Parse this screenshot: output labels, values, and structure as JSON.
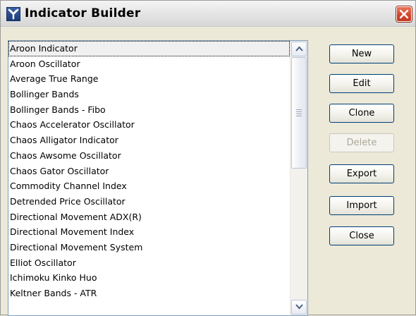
{
  "window": {
    "title": "Indicator Builder",
    "icon": "app-logo-icon",
    "close_icon": "close-icon"
  },
  "indicators": {
    "selected_index": 0,
    "items": [
      "Aroon Indicator",
      "Aroon Oscillator",
      "Average True Range",
      "Bollinger Bands",
      "Bollinger Bands - Fibo",
      "Chaos Accelerator Oscillator",
      "Chaos Alligator Indicator",
      "Chaos Awsome Oscillator",
      "Chaos Gator Oscillator",
      "Commodity Channel Index",
      "Detrended Price Oscillator",
      "Directional Movement ADX(R)",
      "Directional Movement Index",
      "Directional Movement System",
      "Elliot Oscillator",
      "Ichimoku Kinko Huo",
      "Keltner Bands - ATR"
    ]
  },
  "buttons": {
    "new": "New",
    "edit": "Edit",
    "clone": "Clone",
    "delete": "Delete",
    "export": "Export",
    "import": "Import",
    "close": "Close"
  },
  "colors": {
    "window_bg": "#ece9d8",
    "list_border": "#7f9db9",
    "button_border": "#003c74",
    "close_button": "#d0432a"
  }
}
